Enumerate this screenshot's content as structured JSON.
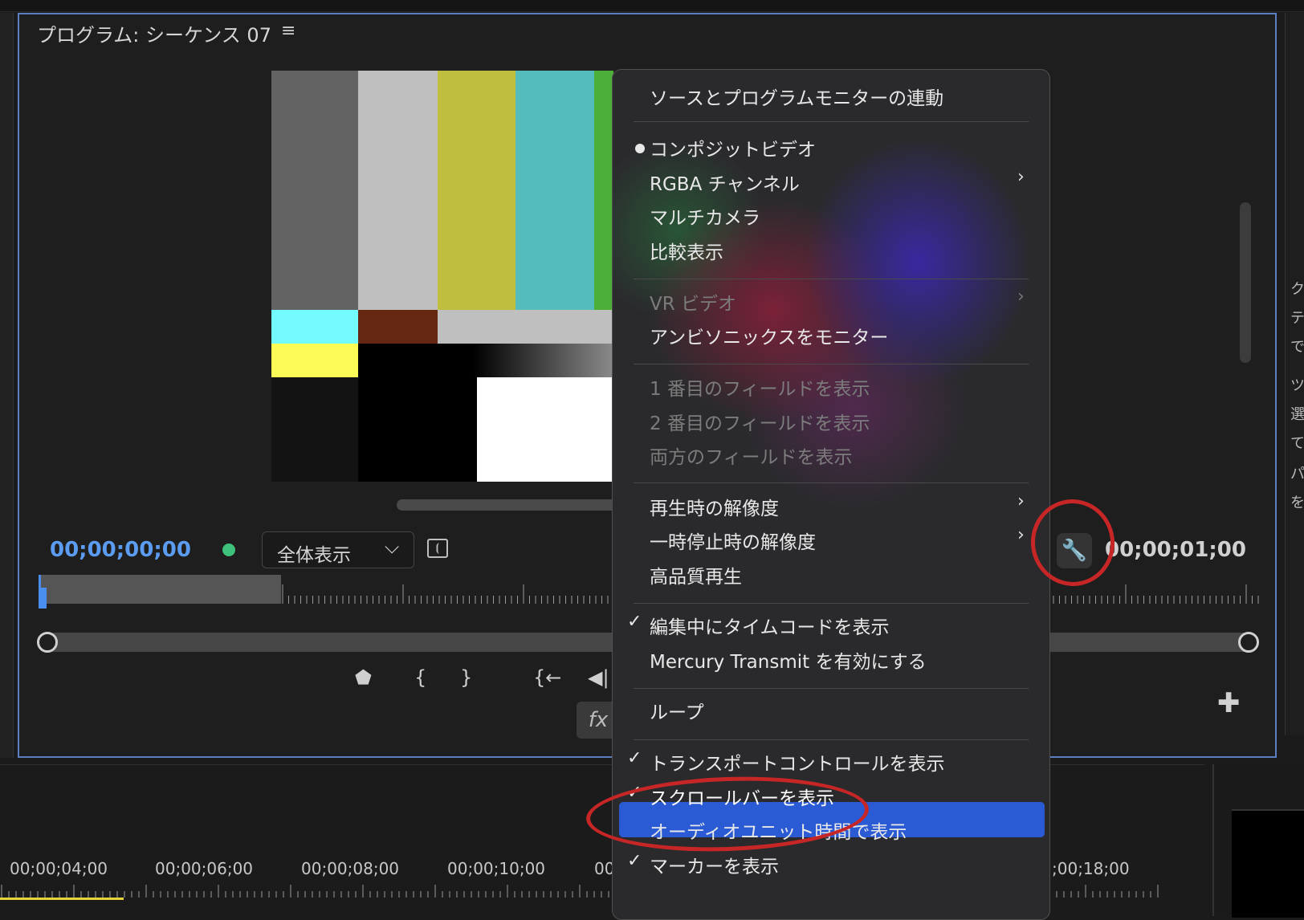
{
  "panel": {
    "title": "プログラム: シーケンス 07",
    "menu_icon": "≡"
  },
  "timecode": {
    "current": "00;00;00;00",
    "duration": "00;00;01;00"
  },
  "zoom": {
    "label": "全体表示",
    "chevron": "⌵"
  },
  "icons": {
    "wrench": "🔧",
    "frame": "⦗",
    "fx": "fx",
    "plus": "✚",
    "marker": "⬟",
    "in": "{",
    "out": "}",
    "goto_in": "{←",
    "step_back": "◀|"
  },
  "menu": {
    "items": [
      {
        "label": "ソースとプログラムモニターの連動"
      },
      {
        "label": "コンポジットビデオ"
      },
      {
        "label": "RGBA チャンネル"
      },
      {
        "label": "マルチカメラ"
      },
      {
        "label": "比較表示"
      },
      {
        "label": "VR ビデオ"
      },
      {
        "label": "アンビソニックスをモニター"
      },
      {
        "label": "1 番目のフィールドを表示"
      },
      {
        "label": "2 番目のフィールドを表示"
      },
      {
        "label": "両方のフィールドを表示"
      },
      {
        "label": "再生時の解像度"
      },
      {
        "label": "一時停止時の解像度"
      },
      {
        "label": "高品質再生"
      },
      {
        "label": "編集中にタイムコードを表示"
      },
      {
        "label": "Mercury Transmit を有効にする"
      },
      {
        "label": "ループ"
      },
      {
        "label": "トランスポートコントロールを表示"
      },
      {
        "label": "スクロールバーを表示"
      },
      {
        "label": "オーディオユニット時間で表示"
      },
      {
        "label": "マーカーを表示"
      }
    ],
    "check": "✓",
    "arrow": "›"
  },
  "timeline": {
    "labels": [
      "00;00;04;00",
      "00;00;06;00",
      "00;00;08;00",
      "00;00;10;00",
      "00",
      ";00;18;00"
    ]
  },
  "right_panel": {
    "glyphs": [
      "ク",
      "テ",
      "で",
      "ツ",
      "選",
      "て",
      "パ",
      "を"
    ]
  }
}
